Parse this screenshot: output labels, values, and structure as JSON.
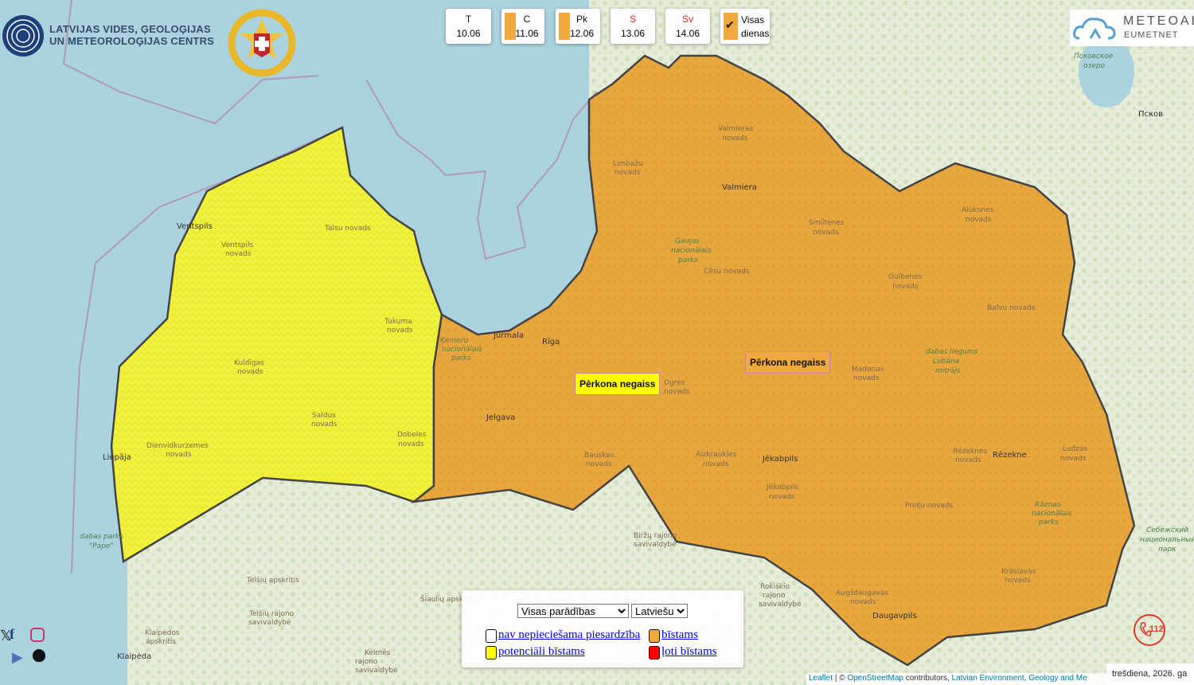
{
  "header": {
    "org_name_line1": "LATVIJAS VIDES, ĢEOLOĢIJAS",
    "org_name_line2": "UN METEOROLOĢIJAS CENTRS"
  },
  "days": [
    {
      "abbr": "T",
      "date": "10.06",
      "color": null,
      "abbr_color": "#111111"
    },
    {
      "abbr": "C",
      "date": "11.06",
      "color": "#f0a93d",
      "abbr_color": "#111111"
    },
    {
      "abbr": "Pk",
      "date": "12.06",
      "color": "#f0a93d",
      "abbr_color": "#111111"
    },
    {
      "abbr": "S",
      "date": "13.06",
      "color": null,
      "abbr_color": "#e02020"
    },
    {
      "abbr": "Sv",
      "date": "14.06",
      "color": null,
      "abbr_color": "#e02020"
    }
  ],
  "all_days": {
    "line1": "Visas",
    "line2": "dienas",
    "checked": true
  },
  "meteoalarm": {
    "name": "METEOAL",
    "sub": "EUMETNET"
  },
  "warnings": {
    "west_label": "Pērkona negaiss",
    "east_label": "Pērkona negaiss",
    "colors": {
      "none": "#ffffff",
      "yellow": "#ffff00",
      "orange": "#f0a93d",
      "red": "#ff0000"
    }
  },
  "legend": {
    "phenomena_selected": "Visas parādības",
    "language_selected": "Latviešu",
    "items": [
      {
        "label": "nav nepieciešama piesardzība",
        "level": "none"
      },
      {
        "label": "bīstams",
        "level": "orange"
      },
      {
        "label": "potenciāli bīstams",
        "level": "yellow"
      },
      {
        "label": "ļoti bīstams",
        "level": "red"
      }
    ]
  },
  "map_labels": {
    "cities": [
      "Ventspils",
      "Liepāja",
      "Jūrmala",
      "Rīga",
      "Jelgava",
      "Valmiera",
      "Jēkabpils",
      "Rēzekne",
      "Daugavpils",
      "Klaipėda",
      "Псков"
    ],
    "regions": [
      "Ventspils novads",
      "Talsu novads",
      "Tukuma novads",
      "Kuldīgas novads",
      "Saldus novads",
      "Dienvidkurzemes novads",
      "Dobeles novads",
      "Bauskas novads",
      "Ogres novads",
      "Limbažu novads",
      "Valmieras novads",
      "Cēsu novads",
      "Smiltenes novads",
      "Alūksnes novads",
      "Gulbenes novads",
      "Balvu novads",
      "Madonas novads",
      "Aizkraukles novads",
      "Jēkabpils novads",
      "Rēzeknes novads",
      "Ludzas novads",
      "Preiļu novads",
      "Krāslavas novads",
      "Augšdaugavas novads",
      "Telšių apskritis",
      "Telšių rajono savivaldybė",
      "Šiaulių apskritis",
      "Klaipėdos apskritis",
      "Kelmės rajono savivaldybė",
      "Biržų rajono savivaldybė",
      "Rokiškio rajono savivaldybė"
    ],
    "parks": [
      "Ķemeru nacionālais parks",
      "Gaujas nacionālais parks",
      "dabas liegums Lubāna mitrājs",
      "Rāznas nacionālais parks",
      "dabas parks \"Pape\"",
      "Псковское озеро",
      "Себежский национальный парк"
    ]
  },
  "attribution": {
    "leaflet": "Leaflet",
    "sep": "| ©",
    "osm": "OpenStreetMap",
    "contrib": "contributors,",
    "lvgmc": "Latvian Environment, Geology and Me"
  },
  "date_text": "trešdiena, 2026. ga",
  "emergency": {
    "number": "112"
  }
}
